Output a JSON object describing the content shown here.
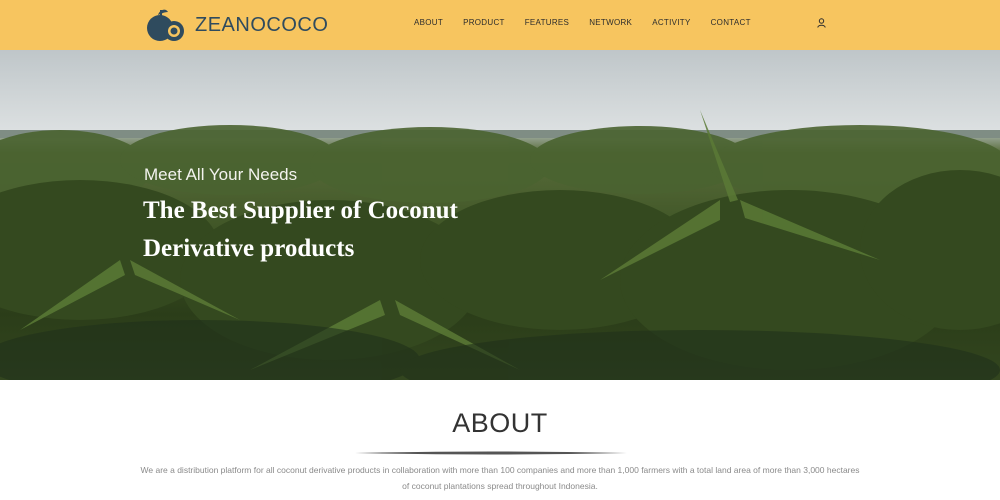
{
  "header": {
    "brand": "ZEANOCOCO",
    "nav": [
      "ABOUT",
      "PRODUCT",
      "FEATURES",
      "NETWORK",
      "ACTIVITY",
      "CONTACT"
    ],
    "user_icon": "user-icon",
    "background_color": "#f7c55f",
    "brand_color": "#2f4b5e"
  },
  "hero": {
    "subtitle": "Meet All Your Needs",
    "title": "The Best Supplier of Coconut Derivative products"
  },
  "about": {
    "title": "ABOUT",
    "text": "We are a distribution platform for all coconut derivative products in collaboration with more than 100 companies and more than 1,000 farmers with a total land area of more than 3,000 hectares of coconut plantations spread throughout Indonesia."
  }
}
